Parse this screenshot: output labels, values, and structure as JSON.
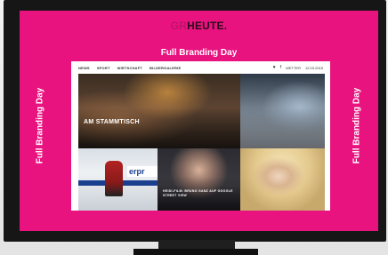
{
  "brand": {
    "logo_prefix": "GR",
    "logo_name": "HEUTE",
    "logo_suffix": ".",
    "primary_color": "#e8137f"
  },
  "banners": {
    "top": "Full Branding Day",
    "left": "Full Branding Day",
    "right": "Full Branding Day"
  },
  "nav": {
    "items": [
      "NEWS",
      "SPORT",
      "WIRTSCHAFT",
      "BILDERGALERIE"
    ],
    "right": {
      "twitter_icon": "twitter-icon",
      "facebook_icon": "facebook-icon",
      "weather": "WETTER",
      "date": "12.03.2015"
    }
  },
  "tiles": [
    {
      "caption": "AM STAMMTISCH"
    },
    {
      "caption": ""
    },
    {
      "caption": ""
    },
    {
      "caption": "HEIDI-FILM: BRUNO GANZ AUF GOOGLE STREET VIEW"
    },
    {
      "caption": ""
    }
  ],
  "ad_text": "erpr"
}
